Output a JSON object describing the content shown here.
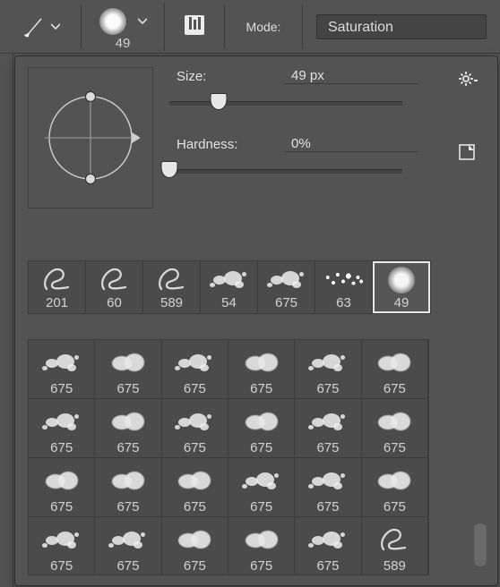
{
  "toolbar": {
    "brush_size_label": "49",
    "mode_label": "Mode:",
    "mode_value": "Saturation"
  },
  "controls": {
    "size_label": "Size:",
    "size_value": "49 px",
    "size_slider_pct": 21,
    "hardness_label": "Hardness:",
    "hardness_value": "0%",
    "hardness_slider_pct": 0
  },
  "recent": [
    {
      "label": "201",
      "kind": "scribble"
    },
    {
      "label": "60",
      "kind": "scribble"
    },
    {
      "label": "589",
      "kind": "scribble"
    },
    {
      "label": "54",
      "kind": "splatter"
    },
    {
      "label": "675",
      "kind": "splatter"
    },
    {
      "label": "63",
      "kind": "dots"
    },
    {
      "label": "49",
      "kind": "soft",
      "selected": true
    }
  ],
  "grid": [
    {
      "label": "675",
      "kind": "splatter"
    },
    {
      "label": "675",
      "kind": "cloud"
    },
    {
      "label": "675",
      "kind": "splatter"
    },
    {
      "label": "675",
      "kind": "cloud"
    },
    {
      "label": "675",
      "kind": "splatter"
    },
    {
      "label": "675",
      "kind": "cloud"
    },
    {
      "label": "675",
      "kind": "splatter"
    },
    {
      "label": "675",
      "kind": "cloud"
    },
    {
      "label": "675",
      "kind": "splatter"
    },
    {
      "label": "675",
      "kind": "cloud"
    },
    {
      "label": "675",
      "kind": "splatter"
    },
    {
      "label": "675",
      "kind": "cloud"
    },
    {
      "label": "675",
      "kind": "cloud"
    },
    {
      "label": "675",
      "kind": "cloud"
    },
    {
      "label": "675",
      "kind": "cloud"
    },
    {
      "label": "675",
      "kind": "splatter"
    },
    {
      "label": "675",
      "kind": "splatter"
    },
    {
      "label": "675",
      "kind": "cloud"
    },
    {
      "label": "675",
      "kind": "splatter"
    },
    {
      "label": "675",
      "kind": "splatter"
    },
    {
      "label": "675",
      "kind": "cloud"
    },
    {
      "label": "675",
      "kind": "cloud"
    },
    {
      "label": "675",
      "kind": "splatter"
    },
    {
      "label": "589",
      "kind": "scribble"
    }
  ]
}
